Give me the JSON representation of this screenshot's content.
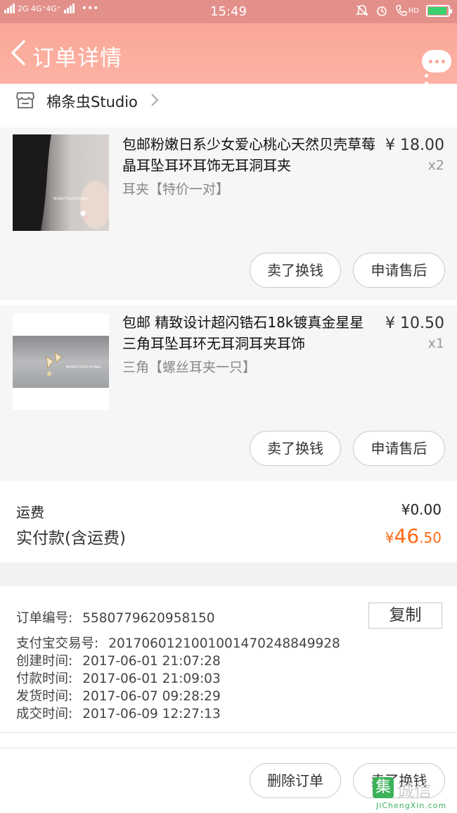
{
  "status_bar": {
    "network": "2G 4G⁺4G⁺",
    "more": "•••",
    "time": "15:49",
    "hd": "HD",
    "battery_percent": 85
  },
  "header": {
    "title": "订单详情"
  },
  "shop": {
    "name": "棉条虫Studio"
  },
  "products": [
    {
      "title": "包邮粉嫩日系少女爱心桃心天然贝壳草莓晶耳坠耳环耳饰无耳洞耳夹",
      "sku": "耳夹【特价一对】",
      "price": "¥ 18.00",
      "qty": "x2",
      "brand_mark": "MIANTIAOCHONG",
      "actions": [
        "卖了换钱",
        "申请售后"
      ]
    },
    {
      "title": "包邮 精致设计超闪锆石18k镀真金星星三角耳坠耳环无耳洞耳夹耳饰",
      "sku": "三角【螺丝耳夹一只】",
      "price": "¥ 10.50",
      "qty": "x1",
      "brand_mark": "MIANTIAOCHONG",
      "actions": [
        "卖了换钱",
        "申请售后"
      ]
    }
  ],
  "totals": {
    "shipping_label": "运费",
    "shipping_value": "¥0.00",
    "paid_label": "实付款(含运费)",
    "paid_currency": "¥",
    "paid_int": "46",
    "paid_dec": ".50"
  },
  "order_info": {
    "copy_label": "复制",
    "rows": [
      {
        "k": "订单编号:",
        "v": "558077962095815​0"
      },
      {
        "k": "支付宝交易号:",
        "v": "2017060121001001470248849928"
      },
      {
        "k": "创建时间:",
        "v": "2017-06-01  21:07:28"
      },
      {
        "k": "付款时间:",
        "v": "2017-06-01  21:09:03"
      },
      {
        "k": "发货时间:",
        "v": "2017-06-07  09:28:29"
      },
      {
        "k": "成交时间:",
        "v": "2017-06-09  12:27:13"
      }
    ]
  },
  "footer": {
    "delete_label": "删除订单",
    "resell_label": "卖了换钱"
  },
  "watermark": {
    "glyph": "集",
    "word": "诚信",
    "url": "JiChengXin.com"
  },
  "colors": {
    "header": "#fdb2a4",
    "status_bar": "#e3908a",
    "price_accent": "#ff6a14",
    "card_bg": "#f6f6f6"
  }
}
